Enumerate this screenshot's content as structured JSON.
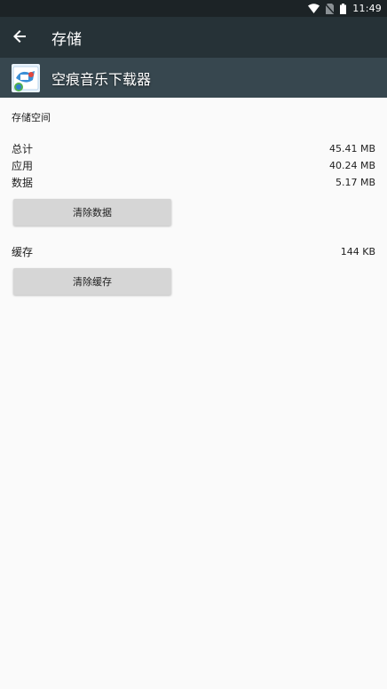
{
  "status_bar": {
    "time": "11:49",
    "icons": [
      "wifi-icon",
      "no-sim-icon",
      "battery-icon"
    ]
  },
  "toolbar": {
    "back_icon": "arrow-back-icon",
    "title": "存储"
  },
  "app": {
    "name": "空痕音乐下载器",
    "icon": "app-icon"
  },
  "storage": {
    "section_title": "存储空间",
    "rows": [
      {
        "label": "总计",
        "value": "45.41 MB"
      },
      {
        "label": "应用",
        "value": "40.24 MB"
      },
      {
        "label": "数据",
        "value": "5.17 MB"
      }
    ],
    "clear_data_label": "清除数据",
    "cache": {
      "label": "缓存",
      "value": "144 KB"
    },
    "clear_cache_label": "清除缓存"
  },
  "colors": {
    "status_bar": "#1c2326",
    "toolbar": "#263237",
    "app_header": "#37474f",
    "background": "#fafafa",
    "button": "#d6d6d6"
  }
}
